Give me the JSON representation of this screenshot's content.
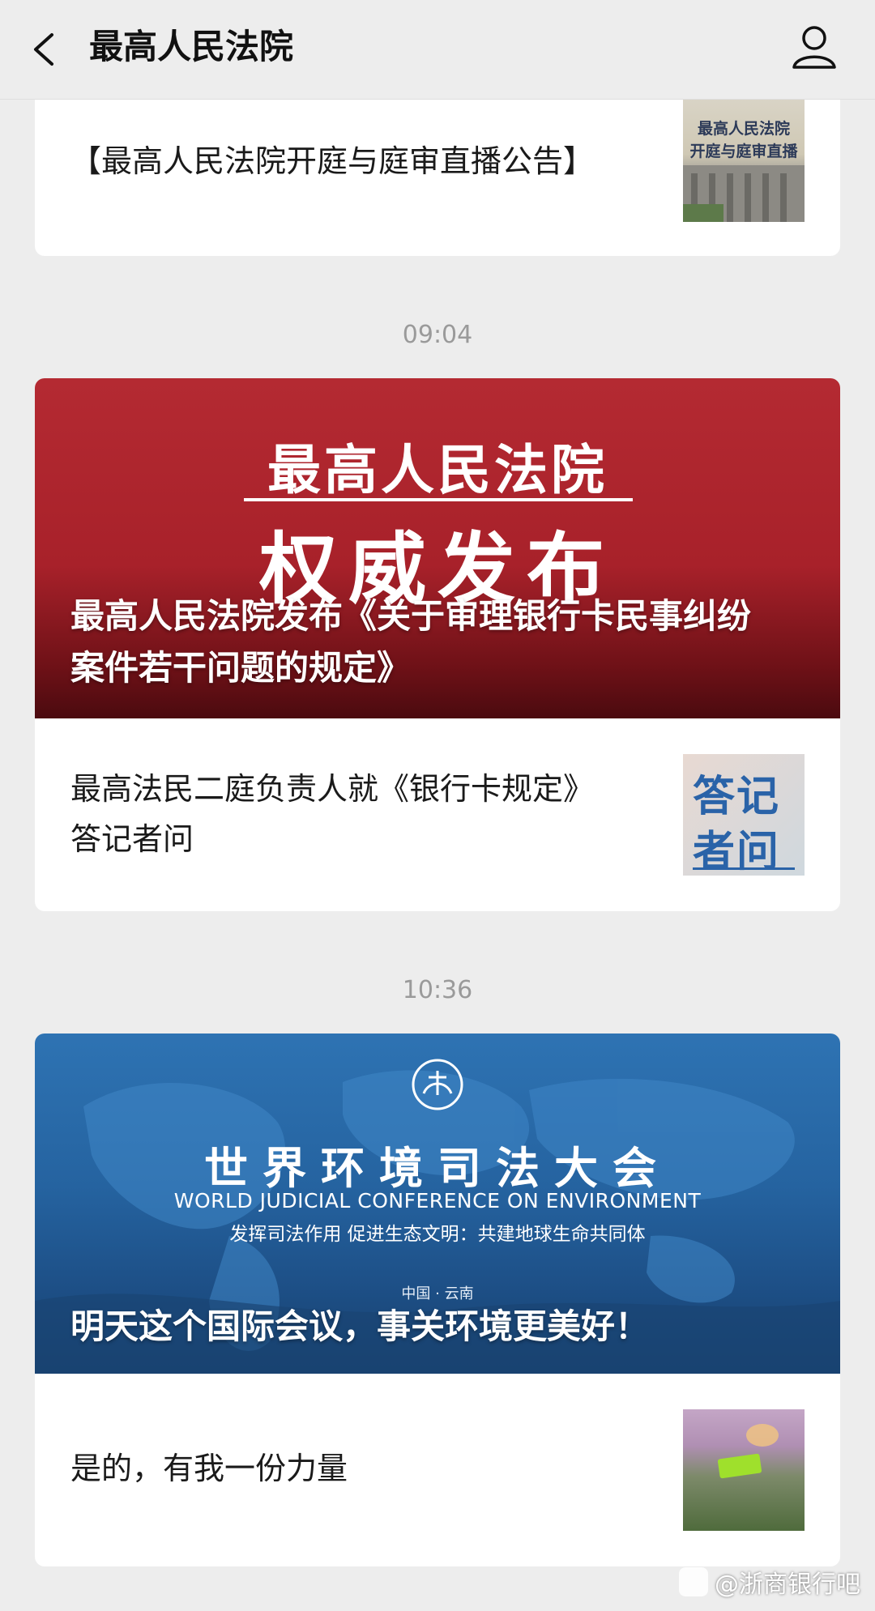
{
  "header": {
    "title": "最高人民法院"
  },
  "card1": {
    "title": "【最高人民法院开庭与庭审直播公告】",
    "thumb_text": [
      "最高人民法院",
      "开庭与庭审直播"
    ]
  },
  "time1": "09:04",
  "card2": {
    "banner_line1": "最高人民法院",
    "banner_line2": "权威发布",
    "headline_line1": "最高人民法院发布《关于审理银行卡民事纠纷",
    "headline_line2": "案件若干问题的规定》",
    "sub_title_line1": "最高法民二庭负责人就《银行卡规定》",
    "sub_title_line2": "答记者问",
    "thumb_text": [
      "答记",
      "者问"
    ]
  },
  "time2": "10:36",
  "card3": {
    "banner_cn": "世界环境司法大会",
    "banner_en": "WORLD JUDICIAL CONFERENCE ON ENVIRONMENT",
    "banner_slogan": "发挥司法作用 促进生态文明：共建地球生命共同体",
    "banner_place": "中国 · 云南",
    "headline": "明天这个国际会议，事关环境更美好！",
    "sub_title": "是的，有我一份力量"
  },
  "watermark": "@浙商银行吧",
  "colors": {
    "background": "#ededed",
    "card": "#ffffff",
    "timestamp": "#9a9a9a",
    "banner_red": "#b3262e",
    "banner_blue": "#2a6aa8"
  },
  "icons": [
    "back-arrow-icon",
    "profile-icon",
    "emblem-icon"
  ]
}
